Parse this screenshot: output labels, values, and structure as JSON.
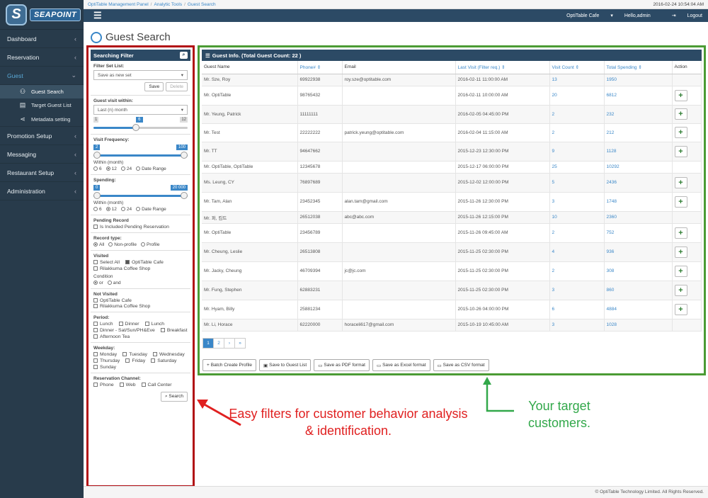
{
  "brand": {
    "logo_letter": "S",
    "logo_text": "SEAPOINT"
  },
  "breadcrumb": [
    "OptiTable Management Panel",
    "Analytic Tools",
    "Guest Search"
  ],
  "datetime": "2016-02-24 10:54:04 AM",
  "topbar": {
    "restaurant": "OptiTable Cafe",
    "user": "Hello,admin",
    "logout": "Logout"
  },
  "sidebar": {
    "items": [
      {
        "label": "Dashboard"
      },
      {
        "label": "Reservation"
      },
      {
        "label": "Guest"
      },
      {
        "label": "Promotion Setup"
      },
      {
        "label": "Messaging"
      },
      {
        "label": "Restaurant Setup"
      },
      {
        "label": "Administration"
      }
    ],
    "sub": [
      {
        "label": "Guest Search",
        "icon": "group-icon"
      },
      {
        "label": "Target Guest List",
        "icon": "list-icon"
      },
      {
        "label": "Metadata setting",
        "icon": "share-icon"
      }
    ]
  },
  "page_title": "Guest Search",
  "filter": {
    "header": "Searching Filter",
    "filter_set_label": "Filter Set List:",
    "filter_set_value": "Save as new set",
    "save": "Save",
    "delete": "Delete",
    "visit_within_label": "Guest visit within:",
    "visit_within_value": "Last (n) month",
    "visit_within": {
      "min": "1",
      "cur": "6",
      "max": "12",
      "value": 6,
      "range": [
        1,
        12
      ]
    },
    "freq_label": "Visit Frequency:",
    "freq": {
      "min": "2",
      "max": "100"
    },
    "within_label": "Within (month)",
    "within_opts": [
      "6",
      "12",
      "24",
      "Date Range"
    ],
    "spending_label": "Spending:",
    "spending": {
      "min": "0",
      "max": "20 000"
    },
    "pending_label": "Pending Record",
    "pending_opt": "Is Included Pending Reservation",
    "record_label": "Record type:",
    "record_opts": [
      "All",
      "Non-profile",
      "Profile"
    ],
    "visited_label": "Visited",
    "select_all": "Select All",
    "visited_opts": [
      "OptiTable Cafe",
      "Rilakkuma Coffee Shop"
    ],
    "condition_label": "Condition",
    "condition_opts": [
      "or",
      "and"
    ],
    "not_visited_label": "Not Visited",
    "not_visited_opts": [
      "OptiTable Cafe",
      "Rilakkuma Coffee Shop"
    ],
    "period_label": "Period:",
    "period_opts": [
      "Lunch",
      "Dinner",
      "Lunch",
      "Dinner - Sat/Sun/PH&Eve",
      "Breakfast",
      "Afternoon Tea"
    ],
    "weekday_label": "Weekday:",
    "weekday_opts": [
      "Monday",
      "Tuesday",
      "Wednesday",
      "Thursday",
      "Friday",
      "Saturday",
      "Sunday"
    ],
    "channel_label": "Reservation Channel:",
    "channel_opts": [
      "Phone",
      "Web",
      "Call Center"
    ],
    "search": "Search"
  },
  "table": {
    "header": "Guest Info. (Total Guest Count: 22 )",
    "columns": [
      "Guest Name",
      "Phone#",
      "Email",
      "Last Visit (Filter req.)",
      "Visit Count",
      "Total Spending",
      "Action"
    ],
    "rows": [
      [
        "Mr. Sze, Roy",
        "69922938",
        "roy.sze@optitable.com",
        "2016-02-11 11:00:00 AM",
        "13",
        "1950",
        false
      ],
      [
        "Mr. OptiTable",
        "98765432",
        "",
        "2016-02-11 10:00:00 AM",
        "20",
        "6812",
        true
      ],
      [
        "Mr. Yeung, Patrick",
        "11111111",
        "",
        "2016-02-05 04:45:00 PM",
        "2",
        "232",
        true
      ],
      [
        "Mr. Test",
        "22222222",
        "patrick.yeung@optitable.com",
        "2016-02-04 11:15:00 AM",
        "2",
        "212",
        true
      ],
      [
        "Mr. TT",
        "94647662",
        "",
        "2015-12-23 12:30:00 PM",
        "9",
        "1128",
        true
      ],
      [
        "Mr. OptiTable, OptiTable",
        "12345678",
        "",
        "2015-12-17 06:00:00 PM",
        "25",
        "10292",
        false
      ],
      [
        "Ms. Leung, CY",
        "76897689",
        "",
        "2015-12-02 12:00:00 PM",
        "5",
        "2436",
        true
      ],
      [
        "Mr. Tam, Alan",
        "23452345",
        "alan.tam@gmail.com",
        "2015-11-26 12:30:00 PM",
        "3",
        "1748",
        true
      ],
      [
        "Mr. 퍼, 킴트",
        "26512038",
        "abc@abc.com",
        "2015-11-26 12:15:00 PM",
        "10",
        "2360",
        false
      ],
      [
        "Mr. OptiTable",
        "23456789",
        "",
        "2015-11-26 09:45:00 AM",
        "2",
        "752",
        true
      ],
      [
        "Mr. Cheung, Leslie",
        "26513808",
        "",
        "2015-11-25 02:30:00 PM",
        "4",
        "936",
        true
      ],
      [
        "Mr. Jacky, Cheung",
        "46709394",
        "jc@jc.com",
        "2015-11-25 02:30:00 PM",
        "2",
        "308",
        true
      ],
      [
        "Mr. Fung, Stephen",
        "62883231",
        "",
        "2015-11-25 02:30:00 PM",
        "3",
        "860",
        true
      ],
      [
        "Mr. Hyam, Billy",
        "25881234",
        "",
        "2015-10-26 04:00:00 PM",
        "6",
        "4884",
        true
      ],
      [
        "Mr. Li, Horace",
        "62220000",
        "horaceli617@gmail.com",
        "2015-10-19 10:45:00 AM",
        "3",
        "1028",
        false
      ]
    ],
    "pager": [
      "1",
      "2",
      "›",
      "»"
    ],
    "actions": [
      "Batch Create Profile",
      "Save to Guest List",
      "Save as PDF format",
      "Save as Excel format",
      "Save as CSV format"
    ]
  },
  "notes": {
    "red": "Easy filters for customer behavior analysis & identification.",
    "green": "Your target customers."
  },
  "footer": "© OptiTable Technology Limited. All Rights Reserved."
}
